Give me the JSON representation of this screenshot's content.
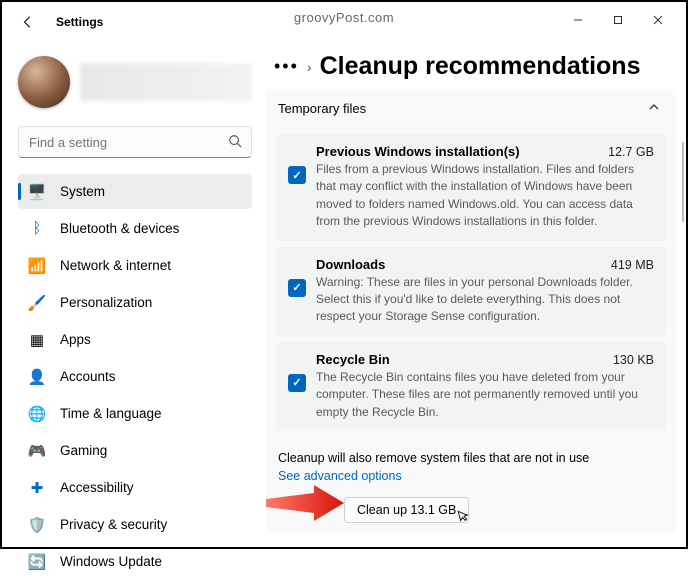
{
  "window": {
    "title": "Settings",
    "watermark": "groovyPost.com"
  },
  "search": {
    "placeholder": "Find a setting"
  },
  "nav": [
    {
      "icon": "🖥️",
      "label": "System",
      "active": true
    },
    {
      "icon": "ᛒ",
      "label": "Bluetooth & devices",
      "iconColor": "#0067c0"
    },
    {
      "icon": "📶",
      "label": "Network & internet",
      "iconColor": "#0067c0"
    },
    {
      "icon": "🖌️",
      "label": "Personalization"
    },
    {
      "icon": "▦",
      "label": "Apps"
    },
    {
      "icon": "👤",
      "label": "Accounts",
      "iconColor": "#3aa36f"
    },
    {
      "icon": "🌐",
      "label": "Time & language",
      "iconColor": "#0067c0"
    },
    {
      "icon": "🎮",
      "label": "Gaming"
    },
    {
      "icon": "✚",
      "label": "Accessibility",
      "iconColor": "#0067c0"
    },
    {
      "icon": "🛡️",
      "label": "Privacy & security"
    },
    {
      "icon": "🔄",
      "label": "Windows Update",
      "iconColor": "#0067c0"
    }
  ],
  "page": {
    "title": "Cleanup recommendations"
  },
  "section": {
    "title": "Temporary files"
  },
  "items": [
    {
      "title": "Previous Windows installation(s)",
      "size": "12.7 GB",
      "desc": "Files from a previous Windows installation.  Files and folders that may conflict with the installation of Windows have been moved to folders named Windows.old.  You can access data from the previous Windows installations in this folder."
    },
    {
      "title": "Downloads",
      "size": "419 MB",
      "desc": "Warning: These are files in your personal Downloads folder. Select this if you'd like to delete everything. This does not respect your Storage Sense configuration."
    },
    {
      "title": "Recycle Bin",
      "size": "130 KB",
      "desc": "The Recycle Bin contains files you have deleted from your computer. These files are not permanently removed until you empty the Recycle Bin."
    }
  ],
  "footer": {
    "note": "Cleanup will also remove system files that are not in use",
    "advanced": "See advanced options",
    "button": "Clean up 13.1 GB"
  }
}
